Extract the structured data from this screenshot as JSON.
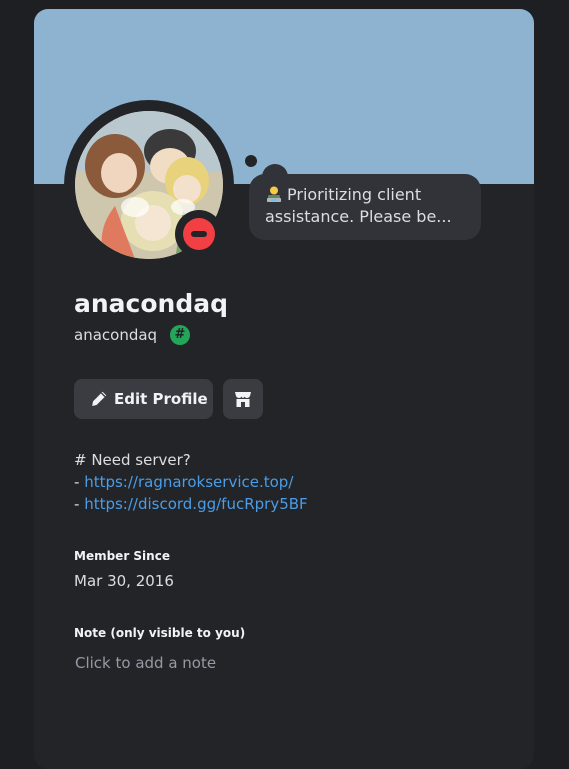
{
  "profile": {
    "display_name": "anacondaq",
    "username": "anacondaq",
    "badge_symbol": "#",
    "status": "do-not-disturb",
    "custom_status": {
      "emoji": "technologist-emoji",
      "text": "Prioritizing client assistance. Please be..."
    }
  },
  "actions": {
    "edit_profile_label": "Edit Profile",
    "shop_icon": "shop-icon"
  },
  "bio": {
    "heading": "# Need server?",
    "lines": [
      {
        "prefix": "- ",
        "link": "https://ragnarokservice.top/"
      },
      {
        "prefix": "- ",
        "link": "https://discord.gg/fucRpry5BF"
      }
    ]
  },
  "member_since": {
    "title": "Member Since",
    "value": "Mar 30, 2016"
  },
  "note": {
    "title": "Note (only visible to you)",
    "placeholder": "Click to add a note",
    "value": ""
  },
  "colors": {
    "banner": "#8eb3d1",
    "card_bg": "#232428",
    "dnd_red": "#f23f43",
    "link": "#4a9de6",
    "badge_green": "#23a55a"
  }
}
